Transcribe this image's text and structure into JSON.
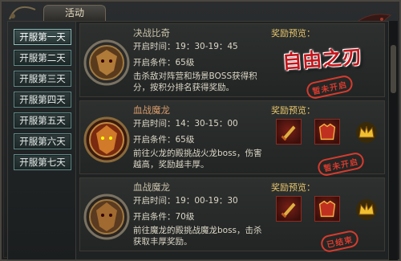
{
  "window": {
    "title": "活动"
  },
  "sidebar": {
    "items": [
      {
        "label": "开服第一天",
        "active": true
      },
      {
        "label": "开服第二天"
      },
      {
        "label": "开服第三天"
      },
      {
        "label": "开服第四天"
      },
      {
        "label": "开服第五天"
      },
      {
        "label": "开服第六天"
      },
      {
        "label": "开服第七天"
      }
    ]
  },
  "events": [
    {
      "title": "决战比奇",
      "time": "开启时间：19：30-19：45",
      "level": "开启条件：65级",
      "desc": "击杀敌对阵营和场景BOSS获得积分，按积分排名获得奖励。",
      "reward_label": "奖励预览：",
      "banner": "自由之刃",
      "stamp": "暂未开启"
    },
    {
      "title": "血战魔龙",
      "time": "开启时间：14：30-15：00",
      "level": "开启条件：65级",
      "desc": "前往火龙的殿挑战火龙boss，伤害越高，奖励越丰厚。",
      "reward_label": "奖励预览：",
      "stamp": "暂未开启"
    },
    {
      "title": "血战魔龙",
      "time": "开启时间：19：00-19：30",
      "level": "开启条件：70级",
      "desc": "前往魔龙的殿挑战魔龙boss，击杀获取丰厚奖励。",
      "reward_label": "奖励预览：",
      "stamp": "已结束"
    }
  ],
  "colors": {
    "accent_gold": "#e8c56a",
    "stamp_red": "#d63b2e",
    "button_border": "#5f8a88"
  }
}
